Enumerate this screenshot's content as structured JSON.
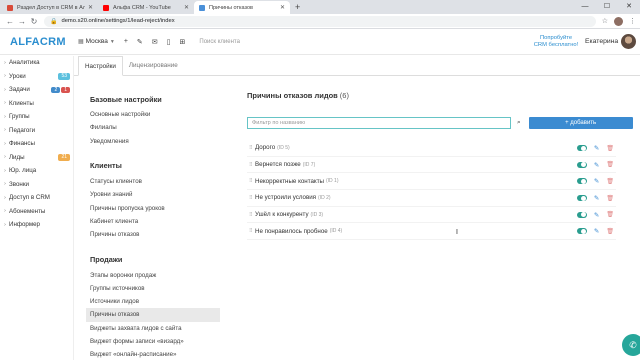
{
  "browser": {
    "tabs": [
      {
        "label": "Раздел Доступ в CRM в Альфа",
        "favicon_color": "#d94b3a",
        "active": false
      },
      {
        "label": "Альфа CRM - YouTube",
        "favicon_color": "#ff0000",
        "active": false
      },
      {
        "label": "Причины отказов",
        "favicon_color": "#4a90d9",
        "active": true
      }
    ],
    "url": "demo.s20.online/settings/1/lead-reject/index",
    "new_tab": "+",
    "window_controls": [
      "—",
      "☐",
      "✕"
    ]
  },
  "header": {
    "logo": "ALFACRM",
    "branch": "Москва",
    "search_placeholder": "Поиск клиента",
    "trial_line1": "Попробуйте",
    "trial_line2": "CRM бесплатно!",
    "user_name": "Екатерина"
  },
  "sidebar": {
    "items": [
      {
        "label": "Аналитика",
        "badges": []
      },
      {
        "label": "Уроки",
        "badges": [
          {
            "text": "53",
            "color": "cyan"
          }
        ]
      },
      {
        "label": "Задачи",
        "badges": [
          {
            "text": "2",
            "color": "blue"
          },
          {
            "text": "1",
            "color": "red"
          }
        ]
      },
      {
        "label": "Клиенты",
        "badges": []
      },
      {
        "label": "Группы",
        "badges": []
      },
      {
        "label": "Педагоги",
        "badges": []
      },
      {
        "label": "Финансы",
        "badges": []
      },
      {
        "label": "Лиды",
        "badges": [
          {
            "text": "21",
            "color": "orange"
          }
        ]
      },
      {
        "label": "Юр. лица",
        "badges": []
      },
      {
        "label": "Звонки",
        "badges": []
      },
      {
        "label": "Доступ в CRM",
        "badges": []
      },
      {
        "label": "Абонементы",
        "badges": []
      },
      {
        "label": "Информер",
        "badges": []
      }
    ]
  },
  "settings_tabs": [
    {
      "label": "Настройки",
      "active": true
    },
    {
      "label": "Лицензирование",
      "active": false
    }
  ],
  "settings_menu": [
    {
      "title": "Базовые настройки",
      "items": [
        {
          "label": "Основные настройки",
          "active": false
        },
        {
          "label": "Филиалы",
          "active": false
        },
        {
          "label": "Уведомления",
          "active": false
        }
      ]
    },
    {
      "title": "Клиенты",
      "items": [
        {
          "label": "Статусы клиентов",
          "active": false
        },
        {
          "label": "Уровни знаний",
          "active": false
        },
        {
          "label": "Причины пропуска уроков",
          "active": false
        },
        {
          "label": "Кабинет клиента",
          "active": false
        },
        {
          "label": "Причины отказов",
          "active": false
        }
      ]
    },
    {
      "title": "Продажи",
      "items": [
        {
          "label": "Этапы воронки продаж",
          "active": false
        },
        {
          "label": "Группы источников",
          "active": false
        },
        {
          "label": "Источники лидов",
          "active": false
        },
        {
          "label": "Причины отказов",
          "active": true
        },
        {
          "label": "Виджеты захвата лидов с сайта",
          "active": false
        },
        {
          "label": "Виджет формы записи «визард»",
          "active": false
        },
        {
          "label": "Виджет «онлайн-расписание»",
          "active": false
        }
      ]
    }
  ],
  "main": {
    "title": "Причины отказов лидов",
    "count": "(6)",
    "filter_placeholder": "Фильтр по названию",
    "add_button": "+ добавить",
    "reasons": [
      {
        "name": "Дорого",
        "id": "(ID 5)",
        "enabled": true
      },
      {
        "name": "Вернется позже",
        "id": "(ID 7)",
        "enabled": true
      },
      {
        "name": "Некорректные контакты",
        "id": "(ID 1)",
        "enabled": true
      },
      {
        "name": "Не устроили условия",
        "id": "(ID 2)",
        "enabled": true
      },
      {
        "name": "Ушёл к конкуренту",
        "id": "(ID 3)",
        "enabled": true
      },
      {
        "name": "Не понравилось пробное",
        "id": "(ID 4)",
        "enabled": true
      }
    ]
  },
  "colors": {
    "accent": "#2b8ecf",
    "toggle_on": "#2a9d8f",
    "add_button": "#3b8bd1"
  }
}
